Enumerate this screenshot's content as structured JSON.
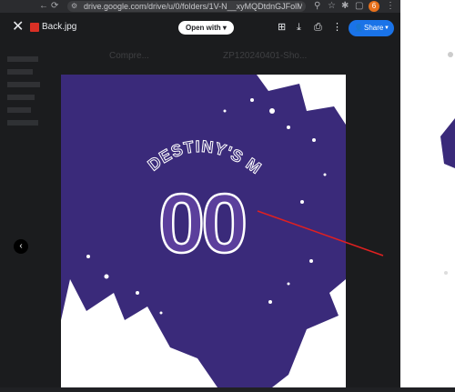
{
  "browser": {
    "url": "drive.google.com/drive/u/0/folders/1V-N__xyMQDtdnGJFolM8I...",
    "profile_initial": "6"
  },
  "viewer": {
    "file_name": "Back.jpg",
    "open_with_label": "Open with",
    "share_label": "Share"
  },
  "background": {
    "ghost_labels": [
      "Compre...",
      "ZP120240401-Sho..."
    ]
  },
  "image": {
    "jersey_text": "DESTINY'S MOM",
    "jersey_number": "00",
    "colors": {
      "field": "#3a2a7a",
      "number_fill": "#5b3f9c",
      "outline": "#ffffff",
      "arrow": "#e02020"
    }
  },
  "icons": {
    "close": "close-icon",
    "back": "back-icon",
    "forward": "forward-icon",
    "reload": "reload-icon",
    "add_to_drive": "add-to-drive-icon",
    "download": "download-icon",
    "print": "print-icon",
    "more": "more-vert-icon",
    "prev": "chevron-left-icon"
  }
}
